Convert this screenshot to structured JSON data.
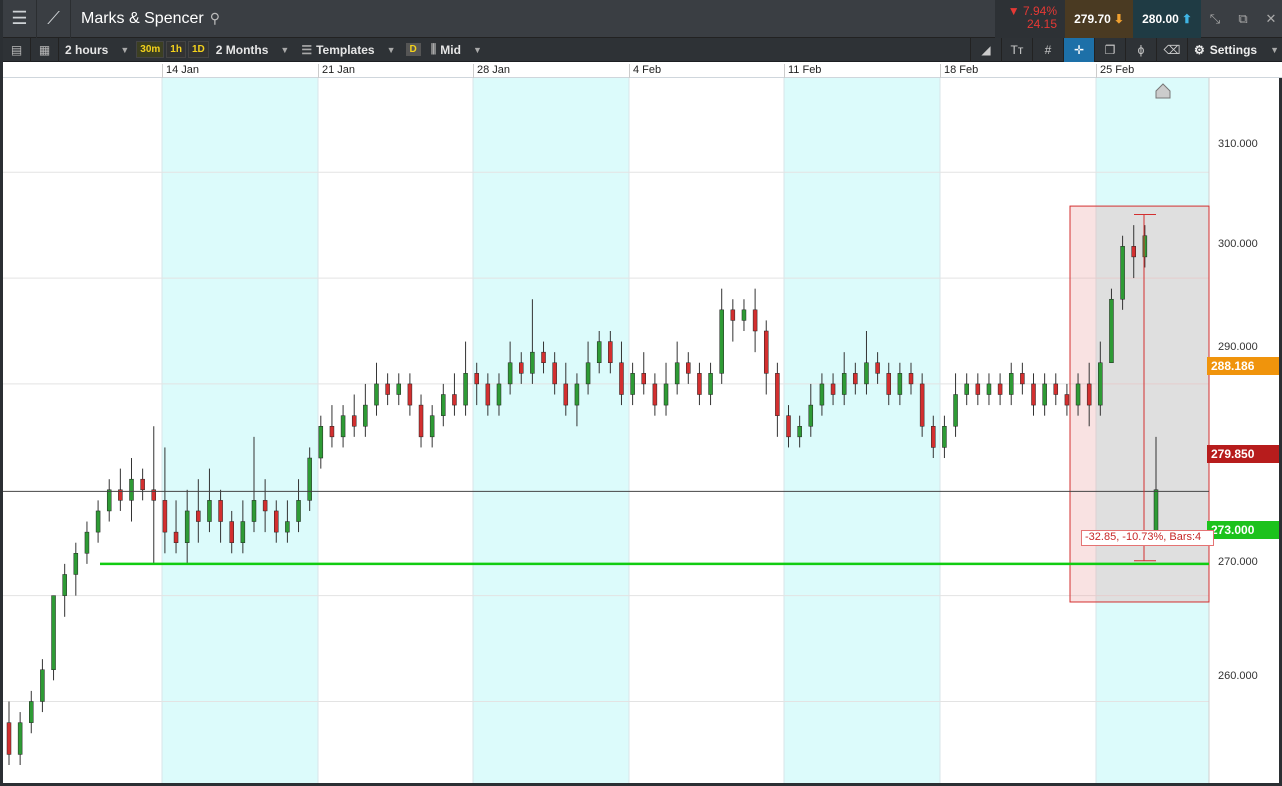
{
  "instrument": {
    "name": "Marks & Spencer"
  },
  "quote": {
    "change_pct": "▼ 7.94%",
    "change_abs": "24.15",
    "sell": "279.70",
    "buy": "280.00"
  },
  "toolbar": {
    "interval": "2 hours",
    "tf_30m": "30m",
    "tf_1h": "1h",
    "tf_1d": "1D",
    "range": "2 Months",
    "templates": "Templates",
    "d_label": "D",
    "price_type": "Mid",
    "settings": "Settings"
  },
  "dates": [
    "14 Jan",
    "21 Jan",
    "28 Jan",
    "4 Feb",
    "11 Feb",
    "18 Feb",
    "25 Feb"
  ],
  "axis": {
    "ticks": [
      "310.000",
      "300.000",
      "290.000",
      "270.000",
      "260.000"
    ]
  },
  "labels": {
    "level1": "288.186",
    "current": "279.850",
    "support": "273.000"
  },
  "measure": {
    "text": "-32.85, -10.73%, Bars:4"
  },
  "colors": {
    "up": "#2e9b35",
    "down": "#d32f2f",
    "shade": "#dcfbfb",
    "support_line": "#11cc11",
    "orange": "#f0940c",
    "red_label": "#b71c1c",
    "green_label": "#1cc21c"
  },
  "chart_data": {
    "type": "candlestick",
    "ylim": [
      252.3,
      318.9
    ],
    "candles": [
      [
        258,
        255,
        260,
        254
      ],
      [
        255,
        258,
        259,
        254
      ],
      [
        258,
        260,
        261,
        257
      ],
      [
        260,
        263,
        264,
        259
      ],
      [
        263,
        270,
        270,
        262
      ],
      [
        270,
        272,
        273,
        268
      ],
      [
        272,
        274,
        275,
        270
      ],
      [
        274,
        276,
        277,
        273
      ],
      [
        276,
        278,
        279,
        275
      ],
      [
        278,
        280,
        281,
        277
      ],
      [
        280,
        279,
        282,
        278
      ],
      [
        279,
        281,
        283,
        277
      ],
      [
        281,
        280,
        282,
        279
      ],
      [
        280,
        279,
        286,
        273
      ],
      [
        279,
        276,
        284,
        274
      ],
      [
        276,
        275,
        279,
        274
      ],
      [
        275,
        278,
        280,
        273
      ],
      [
        278,
        277,
        281,
        275
      ],
      [
        277,
        279,
        282,
        276
      ],
      [
        279,
        277,
        280,
        275
      ],
      [
        277,
        275,
        278,
        274
      ],
      [
        275,
        277,
        279,
        274
      ],
      [
        277,
        279,
        285,
        276
      ],
      [
        279,
        278,
        281,
        276
      ],
      [
        278,
        276,
        279,
        275
      ],
      [
        276,
        277,
        279,
        275
      ],
      [
        277,
        279,
        281,
        276
      ],
      [
        279,
        283,
        284,
        278
      ],
      [
        283,
        286,
        287,
        282
      ],
      [
        286,
        285,
        288,
        284
      ],
      [
        285,
        287,
        288,
        284
      ],
      [
        287,
        286,
        289,
        285
      ],
      [
        286,
        288,
        290,
        285
      ],
      [
        288,
        290,
        292,
        287
      ],
      [
        290,
        289,
        291,
        288
      ],
      [
        289,
        290,
        291,
        288
      ],
      [
        290,
        288,
        291,
        287
      ],
      [
        288,
        285,
        289,
        284
      ],
      [
        285,
        287,
        288,
        284
      ],
      [
        287,
        289,
        290,
        286
      ],
      [
        289,
        288,
        291,
        287
      ],
      [
        288,
        291,
        294,
        287
      ],
      [
        291,
        290,
        292,
        288
      ],
      [
        290,
        288,
        291,
        287
      ],
      [
        288,
        290,
        291,
        287
      ],
      [
        290,
        292,
        294,
        289
      ],
      [
        292,
        291,
        293,
        290
      ],
      [
        291,
        293,
        298,
        290
      ],
      [
        293,
        292,
        294,
        291
      ],
      [
        292,
        290,
        293,
        289
      ],
      [
        290,
        288,
        292,
        287
      ],
      [
        288,
        290,
        291,
        286
      ],
      [
        290,
        292,
        294,
        289
      ],
      [
        292,
        294,
        295,
        291
      ],
      [
        294,
        292,
        295,
        291
      ],
      [
        292,
        289,
        294,
        288
      ],
      [
        289,
        291,
        292,
        288
      ],
      [
        291,
        290,
        293,
        289
      ],
      [
        290,
        288,
        291,
        287
      ],
      [
        288,
        290,
        292,
        287
      ],
      [
        290,
        292,
        294,
        289
      ],
      [
        292,
        291,
        293,
        290
      ],
      [
        291,
        289,
        292,
        288
      ],
      [
        289,
        291,
        292,
        288
      ],
      [
        291,
        297,
        299,
        290
      ],
      [
        297,
        296,
        298,
        294
      ],
      [
        296,
        297,
        298,
        295
      ],
      [
        297,
        295,
        299,
        293
      ],
      [
        295,
        291,
        296,
        289
      ],
      [
        291,
        287,
        292,
        285
      ],
      [
        287,
        285,
        288,
        284
      ],
      [
        285,
        286,
        287,
        284
      ],
      [
        286,
        288,
        290,
        285
      ],
      [
        288,
        290,
        291,
        287
      ],
      [
        290,
        289,
        291,
        288
      ],
      [
        289,
        291,
        293,
        288
      ],
      [
        291,
        290,
        292,
        289
      ],
      [
        290,
        292,
        295,
        289
      ],
      [
        292,
        291,
        293,
        290
      ],
      [
        291,
        289,
        292,
        288
      ],
      [
        289,
        291,
        292,
        288
      ],
      [
        291,
        290,
        292,
        289
      ],
      [
        290,
        286,
        291,
        285
      ],
      [
        286,
        284,
        287,
        283
      ],
      [
        284,
        286,
        287,
        283
      ],
      [
        286,
        289,
        291,
        285
      ],
      [
        289,
        290,
        291,
        288
      ],
      [
        290,
        289,
        291,
        288
      ],
      [
        289,
        290,
        291,
        288
      ],
      [
        290,
        289,
        291,
        288
      ],
      [
        289,
        291,
        292,
        288
      ],
      [
        291,
        290,
        292,
        289
      ],
      [
        290,
        288,
        291,
        287
      ],
      [
        288,
        290,
        291,
        287
      ],
      [
        290,
        289,
        291,
        288
      ],
      [
        289,
        288,
        290,
        287
      ],
      [
        288,
        290,
        291,
        287
      ],
      [
        290,
        288,
        292,
        286
      ],
      [
        288,
        292,
        294,
        287
      ],
      [
        292,
        298,
        299,
        292
      ],
      [
        298,
        303,
        304,
        297
      ],
      [
        303,
        302,
        305,
        300
      ],
      [
        302,
        304,
        305,
        301
      ],
      [
        276,
        280,
        285,
        275
      ]
    ]
  }
}
